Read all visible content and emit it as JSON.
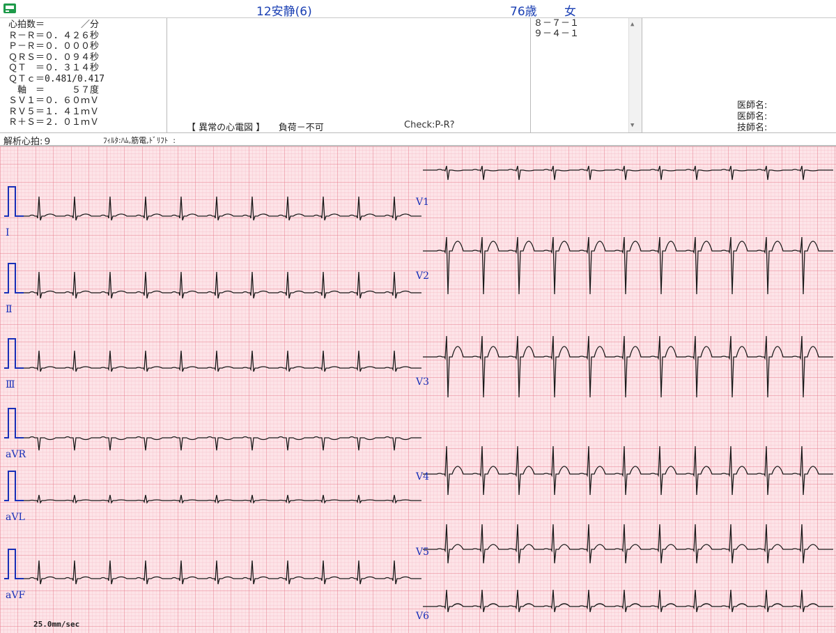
{
  "header": {
    "exam_type": "12安静(6)",
    "age": "76歳",
    "sex": "女"
  },
  "measurements": [
    "心拍数＝　　　　／分",
    "Ｒ－Ｒ＝０．４２６秒",
    "Ｐ－Ｒ＝０．０００秒",
    "ＱＲＳ＝０．０９４秒",
    "ＱＴ　＝０．３１４秒",
    "ＱＴｃ＝0.481/0.417",
    "　軸　＝　　　５７度",
    "ＳＶ１＝０．６０ｍＶ",
    "ＲＶ５＝１．４１ｍＶ",
    "Ｒ＋Ｓ＝２．０１ｍＶ"
  ],
  "finding": {
    "label": "【 異常の心電図 】",
    "stress": "負荷－不可",
    "check": "Check:P-R?"
  },
  "codes": [
    "８－７－１",
    "９－４－１"
  ],
  "signatures": [
    "医師名:",
    "医師名:",
    "技師名:"
  ],
  "analysis": {
    "beats": "解析心拍:９",
    "filter": "ﾌｨﾙﾀ:ﾊﾑ,筋電,ﾄﾞﾘﾌﾄ  :"
  },
  "leads_left": [
    "Ⅰ",
    "Ⅱ",
    "Ⅲ",
    "aVR",
    "aVL",
    "aVF"
  ],
  "leads_right": [
    "V1",
    "V2",
    "V3",
    "V4",
    "V5",
    "V6"
  ],
  "paper_speed": "25.0mm/sec",
  "colors": {
    "grid_bg": "#fde4e8",
    "grid_minor": "#f4b7c2",
    "grid_major": "#e8808f",
    "trace": "#1a1a1a",
    "calibration": "#1830b8",
    "title_text": "#1a3fb3"
  }
}
